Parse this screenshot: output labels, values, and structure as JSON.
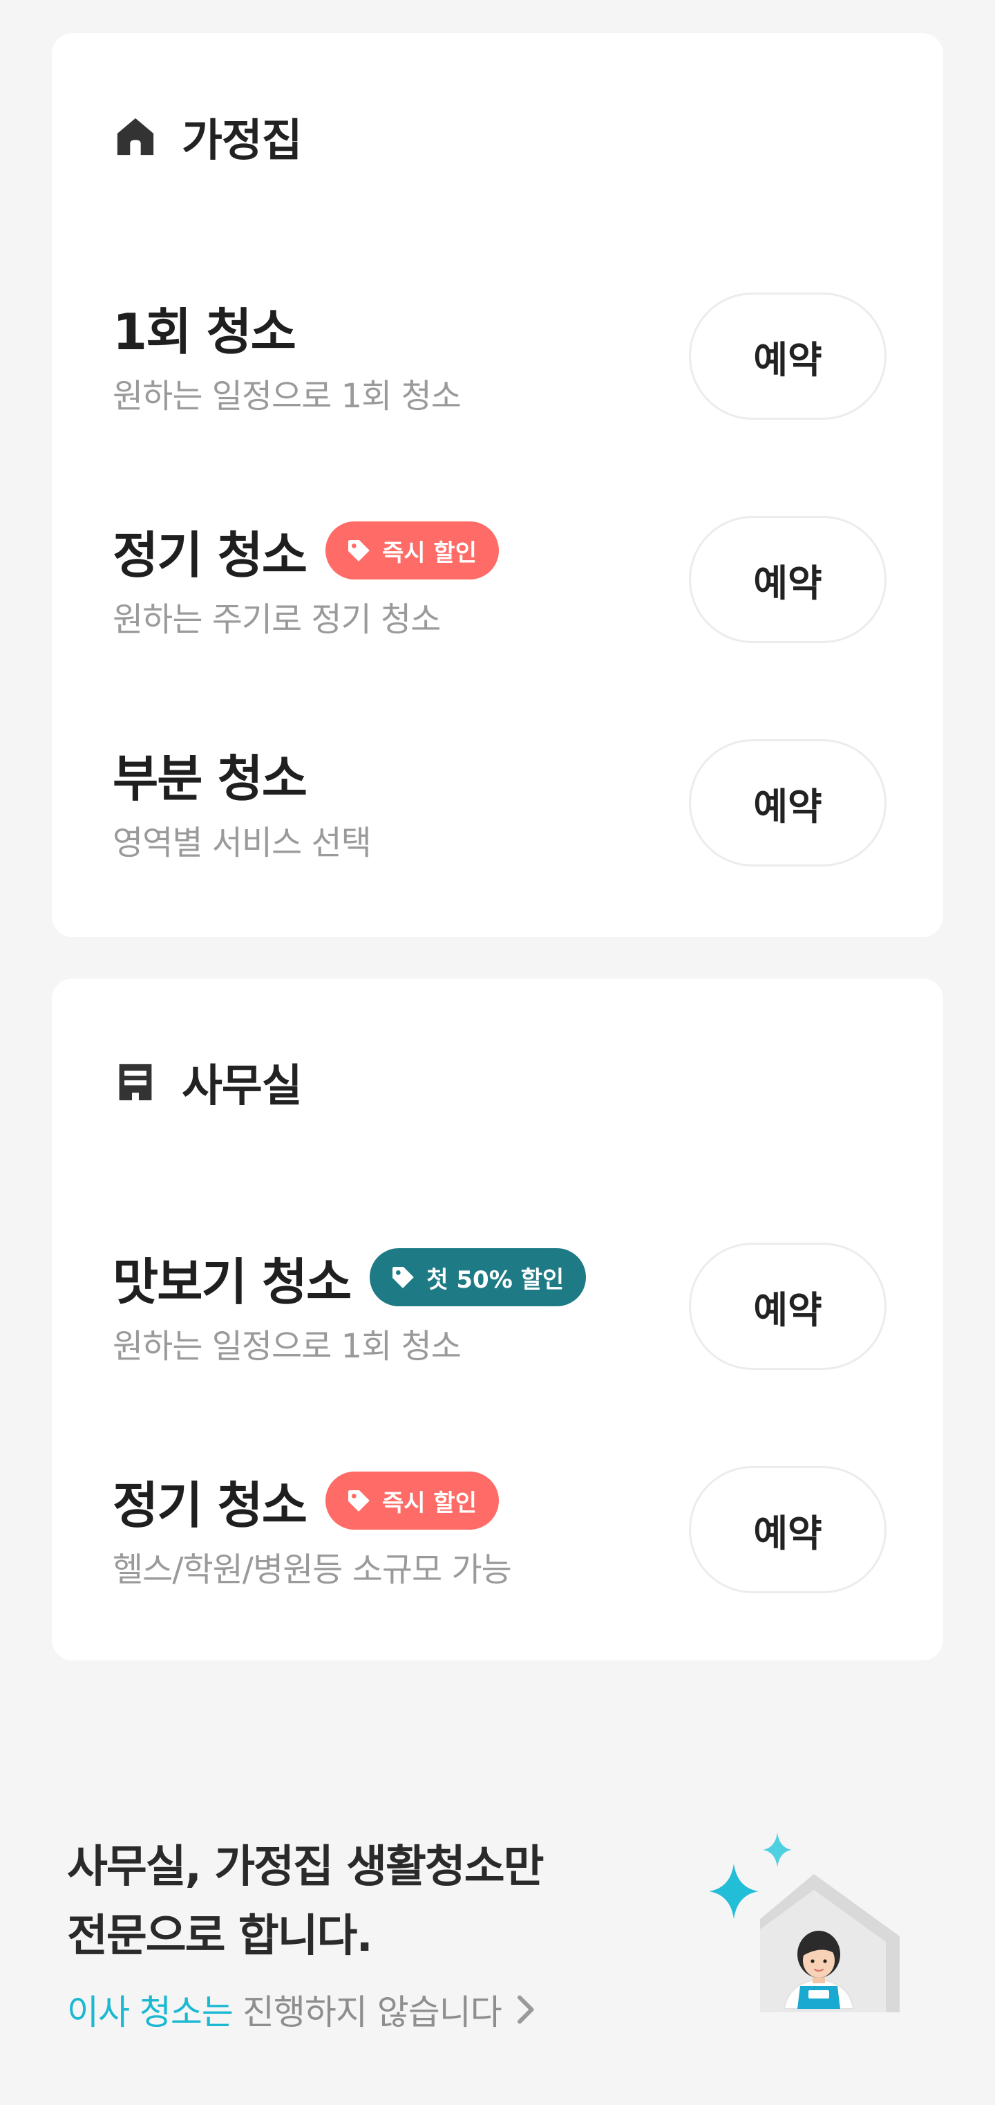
{
  "home": {
    "title": "가정집",
    "icon": "house-icon",
    "services": [
      {
        "name": "1회 청소",
        "description": "원하는 일정으로 1회 청소",
        "badge": null,
        "button": "예약"
      },
      {
        "name": "정기 청소",
        "description": "원하는 주기로 정기 청소",
        "badge": {
          "label": "즉시 할인",
          "color": "#ff6b66"
        },
        "button": "예약"
      },
      {
        "name": "부분 청소",
        "description": "영역별 서비스 선택",
        "badge": null,
        "button": "예약"
      }
    ]
  },
  "office": {
    "title": "사무실",
    "icon": "office-building-icon",
    "services": [
      {
        "name": "맛보기 청소",
        "description": "원하는 일정으로 1회 청소",
        "badge": {
          "label": "첫 50% 할인",
          "color": "#1e7a84"
        },
        "button": "예약"
      },
      {
        "name": "정기 청소",
        "description": "헬스/학원/병원등 소규모 가능",
        "badge": {
          "label": "즉시 할인",
          "color": "#ff6b66"
        },
        "button": "예약"
      }
    ]
  },
  "promo": {
    "headline_line1": "사무실, 가정집 생활청소만",
    "headline_line2": "전문으로 합니다.",
    "link_accent": "이사 청소는",
    "link_rest": "진행하지 않습니다",
    "accent_color": "#1bb8d2"
  }
}
